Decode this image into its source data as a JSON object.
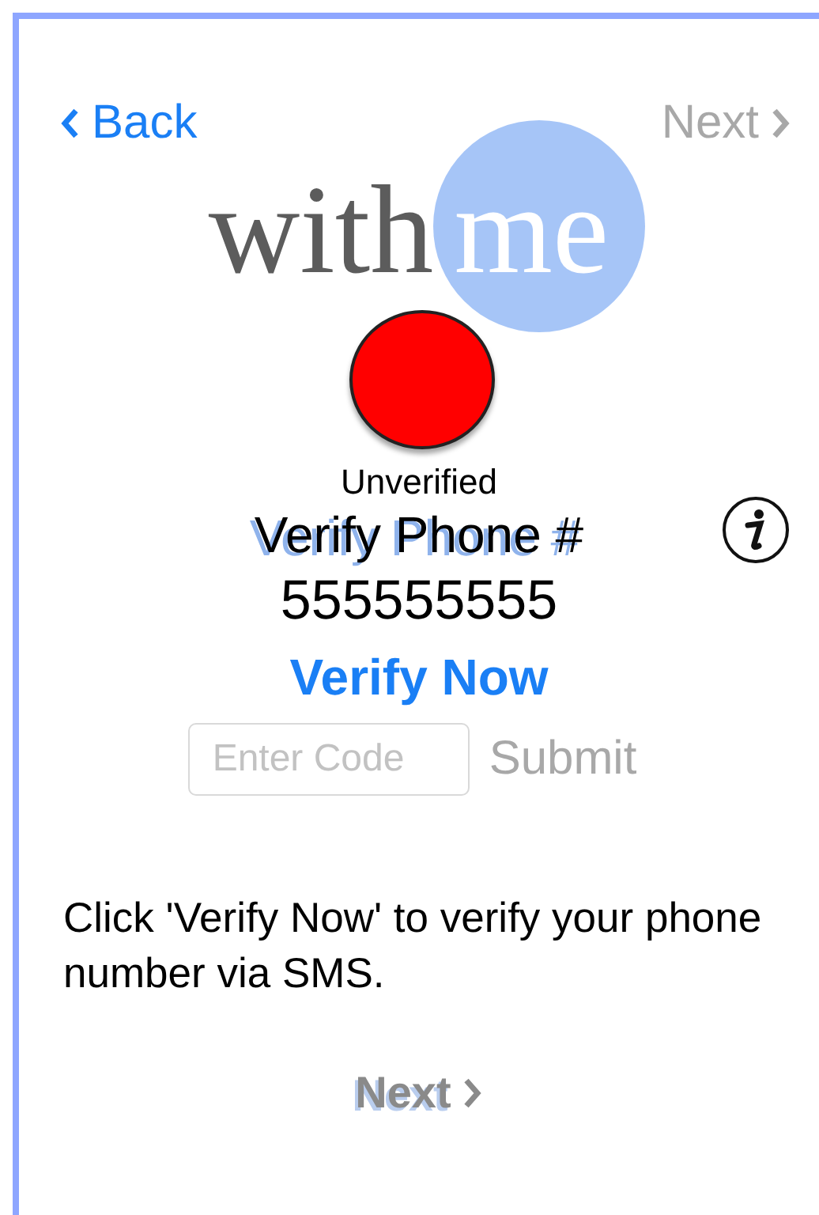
{
  "nav": {
    "back": {
      "label": "Back",
      "disabled": false
    },
    "next": {
      "label": "Next",
      "disabled": true
    }
  },
  "logo": {
    "first": "with",
    "second": "me"
  },
  "status": {
    "label": "Unverified",
    "color": "#ff0000"
  },
  "heading": "Verify Phone #",
  "phone": "555555555",
  "verify_button": {
    "label": "Verify Now",
    "disabled": false
  },
  "code_field": {
    "placeholder": "Enter Code"
  },
  "submit_button": {
    "label": "Submit",
    "disabled": true
  },
  "instructions": "Click 'Verify Now' to verify your phone number via SMS.",
  "footer_next": {
    "label": "Next",
    "disabled": true
  }
}
